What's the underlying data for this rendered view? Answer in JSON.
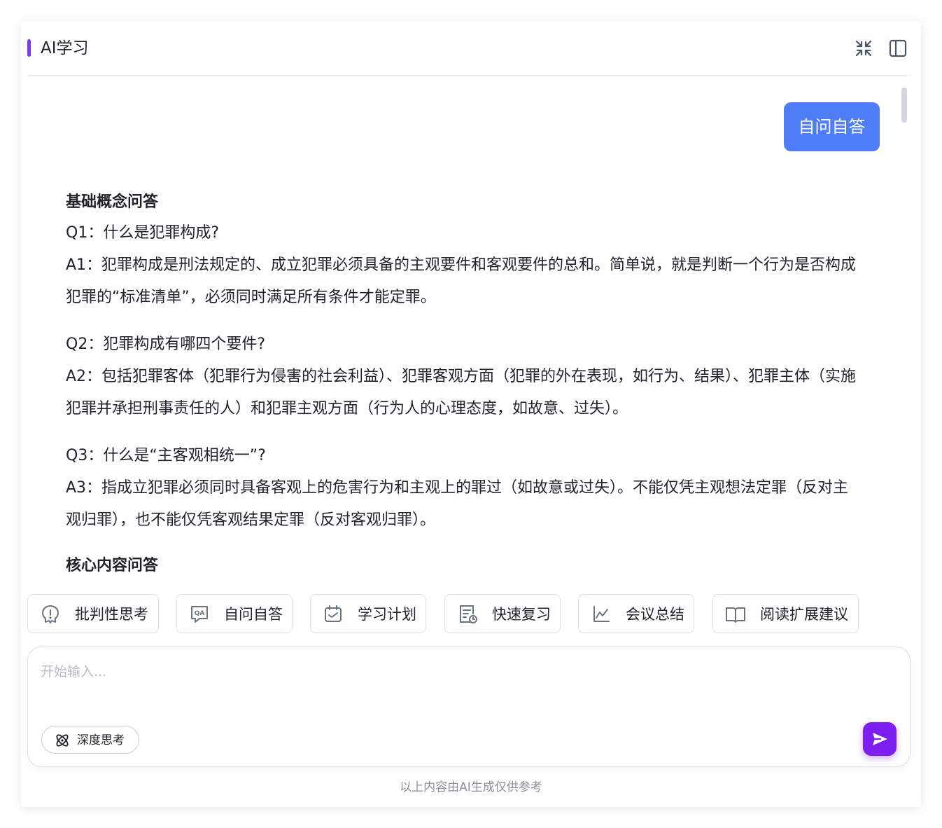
{
  "header": {
    "title": "AI学习"
  },
  "chat": {
    "user_message": "自问自答",
    "answer": {
      "section1_title": "基础概念问答",
      "qa": [
        {
          "q": "Q1：什么是犯罪构成?",
          "a": "A1：犯罪构成是刑法规定的、成立犯罪必须具备的主观要件和客观要件的总和。简单说，就是判断一个行为是否构成犯罪的“标准清单”，必须同时满足所有条件才能定罪。"
        },
        {
          "q": "Q2：犯罪构成有哪四个要件?",
          "a": "A2：包括犯罪客体（犯罪行为侵害的社会利益）、犯罪客观方面（犯罪的外在表现，如行为、结果）、犯罪主体（实施犯罪并承担刑事责任的人）和犯罪主观方面（行为人的心理态度，如故意、过失）。"
        },
        {
          "q": "Q3：什么是“主客观相统一”?",
          "a": "A3：指成立犯罪必须同时具备客观上的危害行为和主观上的罪过（如故意或过失）。不能仅凭主观想法定罪（反对主观归罪），也不能仅凭客观结果定罪（反对客观归罪）。"
        }
      ],
      "section2_title": "核心内容问答"
    }
  },
  "quick_actions": [
    {
      "label": "批判性思考",
      "icon": "bulb-icon"
    },
    {
      "label": "自问自答",
      "icon": "qa-icon"
    },
    {
      "label": "学习计划",
      "icon": "calendar-check-icon"
    },
    {
      "label": "快速复习",
      "icon": "document-clock-icon"
    },
    {
      "label": "会议总结",
      "icon": "line-chart-icon"
    },
    {
      "label": "阅读扩展建议",
      "icon": "open-book-icon"
    }
  ],
  "input": {
    "placeholder": "开始输入...",
    "deep_think_label": "深度思考"
  },
  "footer": {
    "disclaimer": "以上内容由AI生成仅供参考"
  },
  "colors": {
    "accent": "#7c3aed",
    "user_bubble": "#4f7cf7",
    "send_button": "#7c1ff0"
  }
}
